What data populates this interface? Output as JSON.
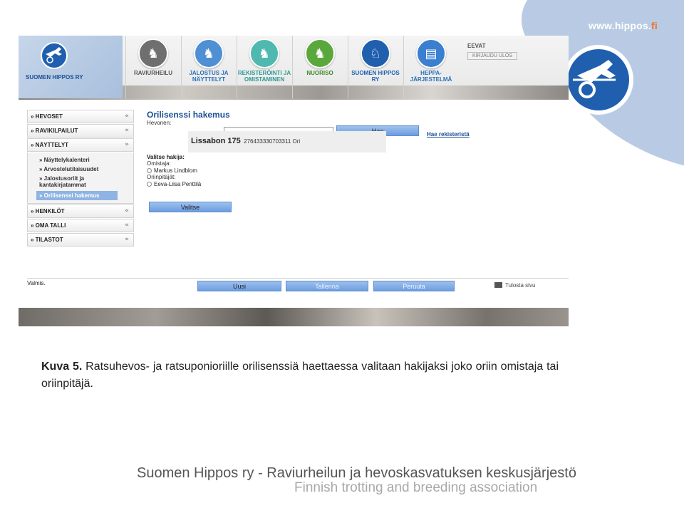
{
  "site": {
    "url_main": "www.hippos.",
    "url_tld": "fi"
  },
  "header": {
    "logo_text": "SUOMEN HIPPOS RY",
    "nav": [
      {
        "label": "RAVIURHEILU",
        "icon": "horse-gray-icon",
        "color": "#6f6f6f"
      },
      {
        "label": "JALOSTUS JA NÄYTTELYT",
        "icon": "horse-blue-icon",
        "color": "#4f8fd3"
      },
      {
        "label": "REKISTERÖINTI JA OMISTAMINEN",
        "icon": "horse-teal-icon",
        "color": "#4fb9b0"
      },
      {
        "label": "NUORISO",
        "icon": "horse-green-icon",
        "color": "#5aa83c"
      },
      {
        "label": "SUOMEN HIPPOS RY",
        "icon": "hippos-logo-icon",
        "color": "#1f5fae"
      },
      {
        "label": "HEPPA-JÄRJESTELMÄ",
        "icon": "document-icon",
        "color": "#3a7fd0"
      }
    ],
    "user_name": "EEVAT",
    "logout_label": "KIRJAUDU ULOS"
  },
  "menu": {
    "items": [
      {
        "label": "HEVOSET",
        "chevron": "«"
      },
      {
        "label": "RAVIKILPAILUT",
        "chevron": "«"
      },
      {
        "label": "NÄYTTELYT",
        "chevron": "»"
      }
    ],
    "submenu": [
      "Näyttelykalenteri",
      "Arvostelutilaisuudet",
      "Jalostusoriit ja kantakirjatammat",
      "Orilisenssi hakemus"
    ],
    "items_after": [
      {
        "label": "HENKILÖT",
        "chevron": "«"
      },
      {
        "label": "OMA TALLI",
        "chevron": "«"
      },
      {
        "label": "TILASTOT",
        "chevron": "«"
      }
    ]
  },
  "form": {
    "title": "Orilisenssi hakemus",
    "horse_label": "Hevonen:",
    "horse_value": "",
    "search_button": "Hae",
    "registry_link": "Hae rekisteristä",
    "result_name": "Lissabon 175",
    "result_details": "276433330703311 Ori",
    "choose_label": "Valitse hakija:",
    "owner_label": "Omistaja:",
    "owner_name": "Markus Lindblom",
    "holder_label": "Oriinpitäjät:",
    "holder_name": "Eeva-Liisa Penttilä",
    "select_button": "Valitse"
  },
  "footer_bar": {
    "status": "Valmis.",
    "new_button": "Uusi",
    "save_button": "Tallenna",
    "cancel_button": "Peruuta",
    "print_label": "Tulosta sivu"
  },
  "caption": {
    "prefix": "Kuva 5.",
    "text": " Ratsuhevos- ja ratsuponioriille orilisenssiä haettaessa valitaan hakijaksi joko oriin omistaja tai oriinpitäjä."
  },
  "org": {
    "line1": "Suomen Hippos ry - Raviurheilun ja hevoskasvatuksen keskusjärjestö",
    "line2": "Finnish trotting and breeding association"
  }
}
